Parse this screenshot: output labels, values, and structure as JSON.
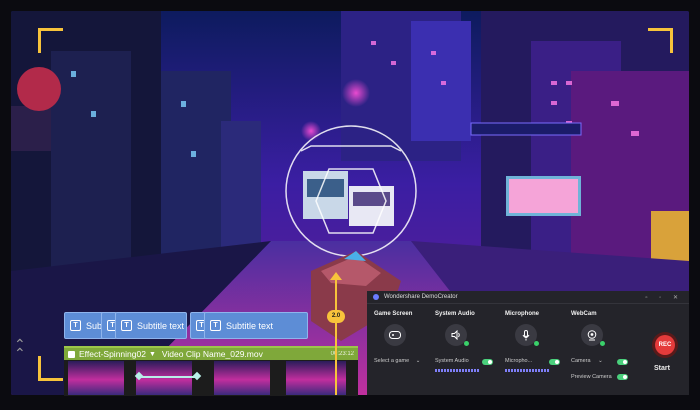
{
  "timeline": {
    "subtitle_tracks": [
      {
        "label": "Sub"
      },
      {
        "label": "Subtitle text"
      },
      {
        "label": "Subtitle text"
      }
    ],
    "text_icon": "T",
    "clip": {
      "effect_name": "Effect-Spinning02",
      "dropdown_icon": "▼",
      "video_name": "Video Clip Name_029.mov",
      "duration": "00:23:12"
    },
    "playhead_label": "2.0"
  },
  "recorder": {
    "title": "Wondershare DemoCreator",
    "columns": [
      {
        "label": "Game Screen",
        "icon": "gamepad-icon",
        "select": "Select a game"
      },
      {
        "label": "System Audio",
        "icon": "speaker-icon",
        "select": "System Audio"
      },
      {
        "label": "Microphone",
        "icon": "microphone-icon",
        "select": "Micropho..."
      },
      {
        "label": "WebCam",
        "icon": "webcam-icon",
        "select": "Camera"
      }
    ],
    "preview_label": "Preview Camera",
    "rec_label": "REC",
    "start_label": "Start"
  },
  "colors": {
    "accent": "#f7c33b",
    "subtitle_track": "#5d8dd6",
    "clip_track": "#7fa83a",
    "rec_red": "#e43b3b"
  }
}
